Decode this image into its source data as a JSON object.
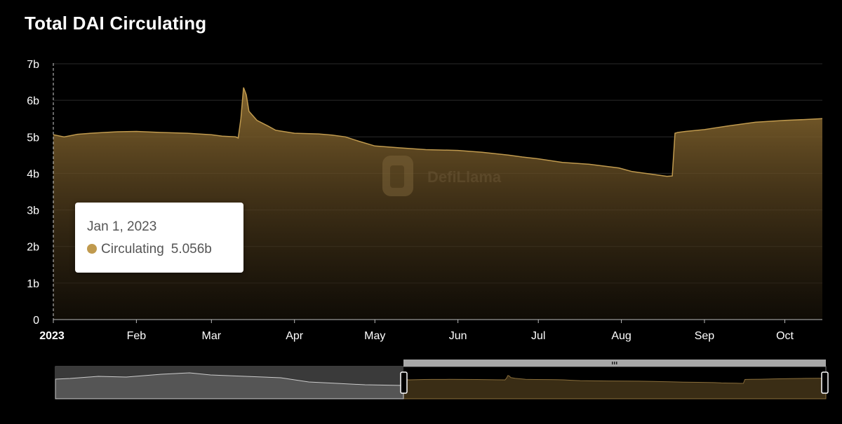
{
  "title": "Total DAI Circulating",
  "colors": {
    "background": "#000000",
    "series": "#c09a4e",
    "selected_window": "#ffffff"
  },
  "watermark": "DefiLlama",
  "tooltip": {
    "date": "Jan 1, 2023",
    "series_name": "Circulating",
    "value": "5.056b"
  },
  "chart_data": {
    "type": "area",
    "title": "Total DAI Circulating",
    "xlabel": "",
    "ylabel": "",
    "ylim": [
      0,
      7
    ],
    "y_ticks": [
      "0",
      "1b",
      "2b",
      "3b",
      "4b",
      "5b",
      "6b",
      "7b"
    ],
    "x_ticks": [
      "2023",
      "Feb",
      "Mar",
      "Apr",
      "May",
      "Jun",
      "Jul",
      "Aug",
      "Sep",
      "Oct"
    ],
    "grid": true,
    "legend": "none",
    "series": [
      {
        "name": "Circulating",
        "units": "billions",
        "x": [
          "2023-01-01",
          "2023-01-05",
          "2023-01-10",
          "2023-01-15",
          "2023-01-20",
          "2023-01-25",
          "2023-02-01",
          "2023-02-10",
          "2023-02-20",
          "2023-03-01",
          "2023-03-05",
          "2023-03-10",
          "2023-03-11",
          "2023-03-12",
          "2023-03-13",
          "2023-03-14",
          "2023-03-15",
          "2023-03-18",
          "2023-03-22",
          "2023-03-25",
          "2023-04-01",
          "2023-04-10",
          "2023-04-15",
          "2023-04-20",
          "2023-04-25",
          "2023-05-01",
          "2023-05-10",
          "2023-05-20",
          "2023-06-01",
          "2023-06-10",
          "2023-06-20",
          "2023-06-25",
          "2023-07-01",
          "2023-07-10",
          "2023-07-20",
          "2023-07-31",
          "2023-08-05",
          "2023-08-10",
          "2023-08-15",
          "2023-08-18",
          "2023-08-20",
          "2023-08-21",
          "2023-08-22",
          "2023-08-25",
          "2023-09-01",
          "2023-09-10",
          "2023-09-20",
          "2023-10-01",
          "2023-10-10",
          "2023-10-15"
        ],
        "y": [
          5.06,
          5.0,
          5.07,
          5.1,
          5.12,
          5.14,
          5.15,
          5.12,
          5.1,
          5.06,
          5.02,
          5.0,
          4.97,
          5.5,
          6.35,
          6.15,
          5.7,
          5.45,
          5.3,
          5.18,
          5.1,
          5.08,
          5.05,
          5.0,
          4.88,
          4.75,
          4.7,
          4.65,
          4.63,
          4.58,
          4.5,
          4.45,
          4.4,
          4.3,
          4.25,
          4.15,
          4.05,
          4.0,
          3.95,
          3.92,
          3.93,
          5.1,
          5.12,
          5.15,
          5.2,
          5.3,
          5.4,
          5.45,
          5.48,
          5.5
        ]
      }
    ],
    "data_zoom": {
      "window_start": "2023-01-01",
      "window_end": "2023-10-15"
    }
  }
}
